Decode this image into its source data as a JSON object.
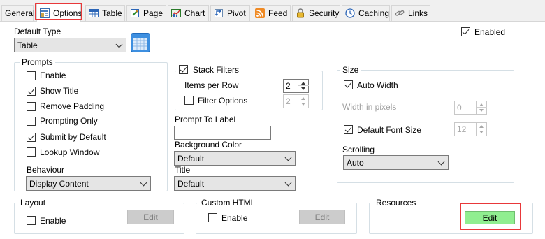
{
  "tabs": [
    {
      "label": "General",
      "icon": "none"
    },
    {
      "label": "Options",
      "icon": "options-icon",
      "active": true
    },
    {
      "label": "Table",
      "icon": "table-icon"
    },
    {
      "label": "Page",
      "icon": "page-icon"
    },
    {
      "label": "Chart",
      "icon": "chart-icon"
    },
    {
      "label": "Pivot",
      "icon": "pivot-icon"
    },
    {
      "label": "Feed",
      "icon": "rss-icon"
    },
    {
      "label": "Security",
      "icon": "lock-icon"
    },
    {
      "label": "Caching",
      "icon": "clock-icon"
    },
    {
      "label": "Links",
      "icon": "link-icon"
    }
  ],
  "default_type": {
    "label": "Default Type",
    "value": "Table"
  },
  "enabled": {
    "label": "Enabled",
    "checked": true
  },
  "prompts": {
    "title": "Prompts",
    "enable": {
      "label": "Enable",
      "checked": false
    },
    "show_title": {
      "label": "Show Title",
      "checked": true
    },
    "remove_padding": {
      "label": "Remove Padding",
      "checked": false
    },
    "prompting_only": {
      "label": "Prompting Only",
      "checked": false
    },
    "submit_by_default": {
      "label": "Submit by Default",
      "checked": true
    },
    "lookup_window": {
      "label": "Lookup Window",
      "checked": false
    },
    "behaviour": {
      "label": "Behaviour",
      "value": "Display Content"
    }
  },
  "stack_filters": {
    "label": "Stack Filters",
    "checked": true,
    "items_per_row": {
      "label": "Items per Row",
      "value": "2"
    },
    "filter_options": {
      "label": "Filter Options",
      "checked": false,
      "value": "2"
    }
  },
  "prompt_to_label": {
    "label": "Prompt To Label",
    "value": ""
  },
  "background_color": {
    "label": "Background Color",
    "value": "Default"
  },
  "title": {
    "label": "Title",
    "value": "Default"
  },
  "size": {
    "title": "Size",
    "auto_width": {
      "label": "Auto Width",
      "checked": true
    },
    "width_in_pixels": {
      "label": "Width in pixels",
      "value": "0"
    },
    "default_font_size": {
      "label": "Default Font Size",
      "checked": true,
      "value": "12"
    },
    "scrolling": {
      "label": "Scrolling",
      "value": "Auto"
    }
  },
  "layout": {
    "title": "Layout",
    "enable_label": "Enable",
    "checked": false,
    "edit_label": "Edit"
  },
  "custom_html": {
    "title": "Custom HTML",
    "enable_label": "Enable",
    "checked": false,
    "edit_label": "Edit"
  },
  "resources": {
    "title": "Resources",
    "edit_label": "Edit"
  },
  "colors": {
    "highlight": "#e8383a",
    "edit_green": "#90ee90",
    "disabled_button": "#cccccc",
    "group_border": "#d5dfe5"
  }
}
